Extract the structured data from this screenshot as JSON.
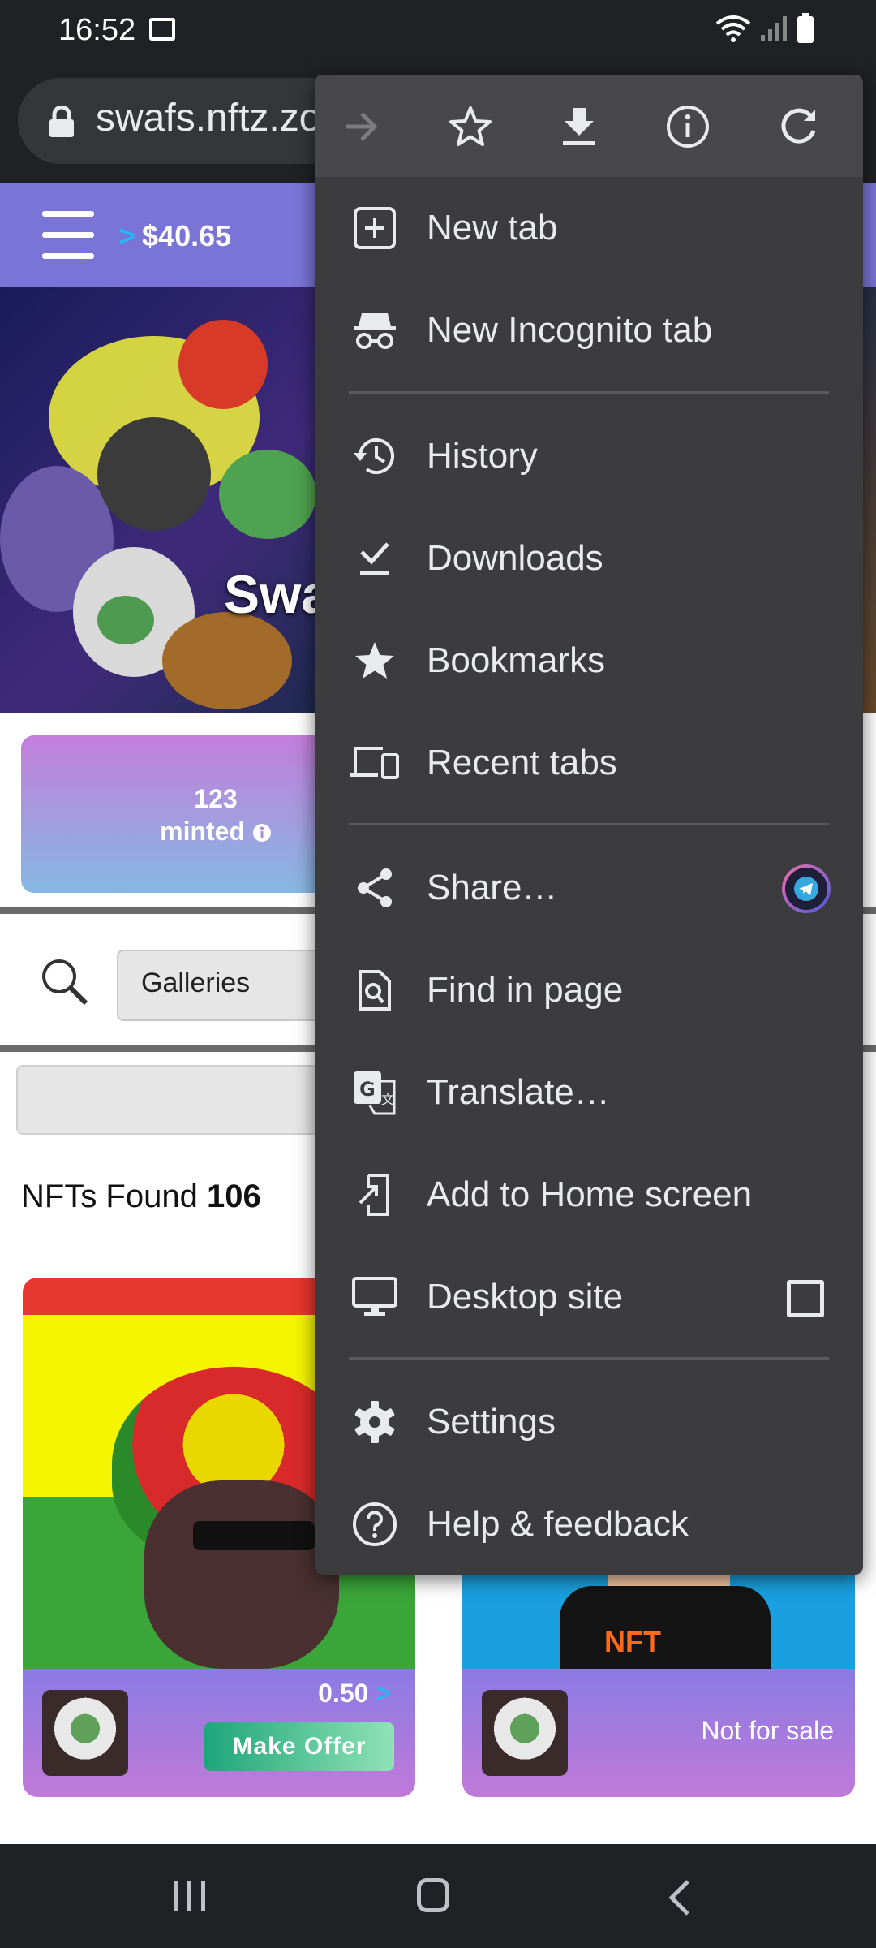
{
  "status_bar": {
    "time": "16:52"
  },
  "url_bar": {
    "url": "swafs.nftz.zone"
  },
  "page": {
    "balance": "$40.65",
    "banner_title": "Swafs",
    "stats": {
      "minted": "123",
      "minted_label": "minted"
    },
    "search": {
      "select_value": "Galleries"
    },
    "nfts_found_label": "NFTs Found",
    "nfts_found_count": "106",
    "cards": [
      {
        "price": "0.50",
        "button": "Make Offer",
        "art_text": ""
      },
      {
        "status": "Not for sale",
        "art_text": "NFT"
      }
    ]
  },
  "menu": {
    "top_icons": [
      "forward-icon",
      "bookmark-star-icon",
      "download-icon",
      "info-icon",
      "refresh-icon"
    ],
    "items": [
      {
        "label": "New tab",
        "icon": "new-tab-icon"
      },
      {
        "label": "New Incognito tab",
        "icon": "incognito-icon"
      },
      {
        "label": "History",
        "icon": "history-icon"
      },
      {
        "label": "Downloads",
        "icon": "downloads-icon"
      },
      {
        "label": "Bookmarks",
        "icon": "bookmarks-icon"
      },
      {
        "label": "Recent tabs",
        "icon": "recent-tabs-icon"
      },
      {
        "label": "Share…",
        "icon": "share-icon"
      },
      {
        "label": "Find in page",
        "icon": "find-in-page-icon"
      },
      {
        "label": "Translate…",
        "icon": "translate-icon"
      },
      {
        "label": "Add to Home screen",
        "icon": "add-to-home-icon"
      },
      {
        "label": "Desktop site",
        "icon": "desktop-icon",
        "checked": false
      },
      {
        "label": "Settings",
        "icon": "settings-icon"
      },
      {
        "label": "Help & feedback",
        "icon": "help-icon"
      }
    ]
  },
  "colors": {
    "menu_bg": "#3c3c3e",
    "header_purple": "#7a74d6",
    "accent_blue": "#29b6f6"
  }
}
